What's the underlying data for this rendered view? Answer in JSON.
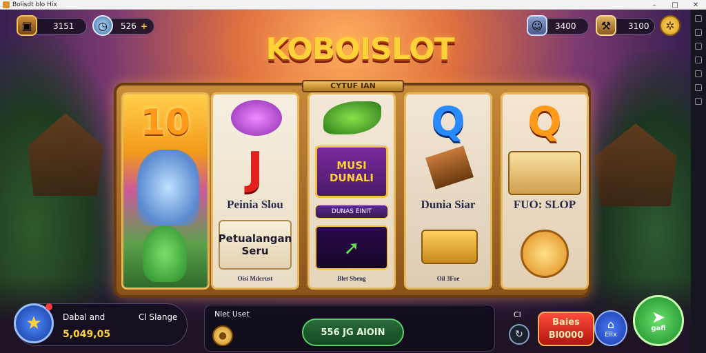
{
  "window": {
    "title": "Bolisdt blo Hix"
  },
  "hud": {
    "chest_value": "3151",
    "clock_value": "526",
    "clock_plus": "+",
    "gem_value": "3400",
    "tools_value": "3100"
  },
  "logo": {
    "text": "KOBOISLOT"
  },
  "frame": {
    "title": "CYTUF IAN"
  },
  "reels": {
    "r1": {
      "top": "10"
    },
    "r2": {
      "letter": "J",
      "caption": "Peinia Slou",
      "tile_text": "Petualangan Seru",
      "tile_caption": "Oisi Mdcrust"
    },
    "r3": {
      "tile_text": "MUSI DUNALI",
      "bar_text": "DUNAS EINIT",
      "tile_caption": "Blet Sbeng"
    },
    "r4": {
      "letter": "Q",
      "caption": "Dunia Siar",
      "tile_caption": "Oil 3Foe"
    },
    "r5": {
      "letter": "Q",
      "caption": "FUO: SLOP"
    }
  },
  "bottom": {
    "label_left": "Dabal and",
    "label_right": "Cl Slange",
    "balance": "5,049,05",
    "center_label": "Nlet Uset",
    "spin_amount": "556 JG AlOIN",
    "cl_label": "Cl",
    "bonus_line1": "Baies",
    "bonus_line2": "Bl0000",
    "tag_label": "Elix",
    "play_label": "gafi"
  },
  "colors": {
    "accent_gold": "#ffd23a",
    "frame_wood": "#c88a3a",
    "play_green": "#1a8a2a",
    "bonus_red": "#b0160e"
  }
}
